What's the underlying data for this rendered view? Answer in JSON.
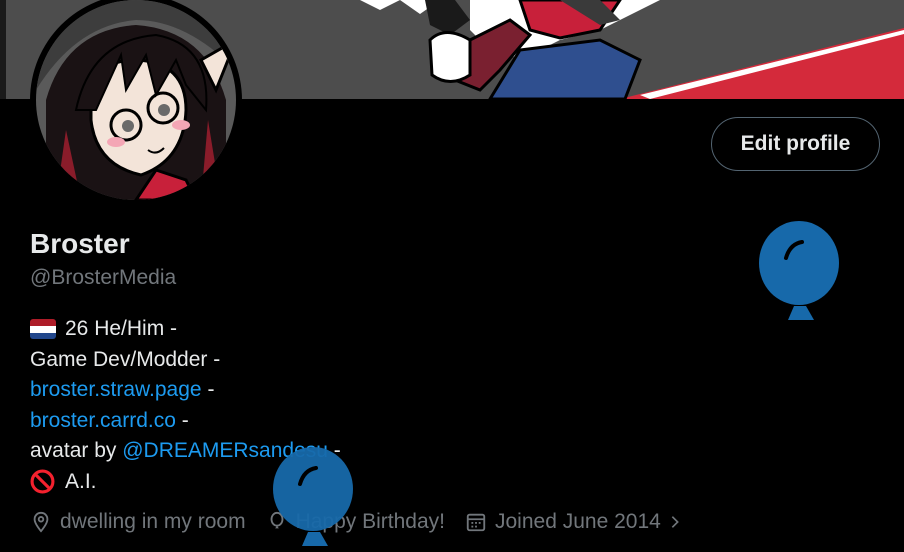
{
  "profile": {
    "display_name": "Broster",
    "handle": "@BrosterMedia",
    "edit_button_label": "Edit profile"
  },
  "bio": {
    "line1_text": "26 He/Him -",
    "line2_text": "Game Dev/Modder -",
    "link1": "broster.straw.page",
    "link1_suffix": " -",
    "link2": "broster.carrd.co",
    "link2_suffix": " -",
    "avatar_credit_prefix": "avatar by ",
    "avatar_credit_mention": "@DREAMERsandesu",
    "avatar_credit_suffix": " -",
    "noai_text": "A.I."
  },
  "meta": {
    "location": "dwelling in my room",
    "birthday": "Happy Birthday!",
    "joined": "Joined June 2014"
  },
  "colors": {
    "accent": "#1d9bf0",
    "secondary_text": "#71767b",
    "balloon": "#1769aa",
    "banner_red": "#d42a3b"
  },
  "icons": {
    "location": "location-pin-icon",
    "birthday": "balloon-icon",
    "joined": "calendar-icon",
    "more": "chevron-right-icon",
    "flag": "netherlands-flag-icon",
    "noai": "prohibited-icon"
  }
}
